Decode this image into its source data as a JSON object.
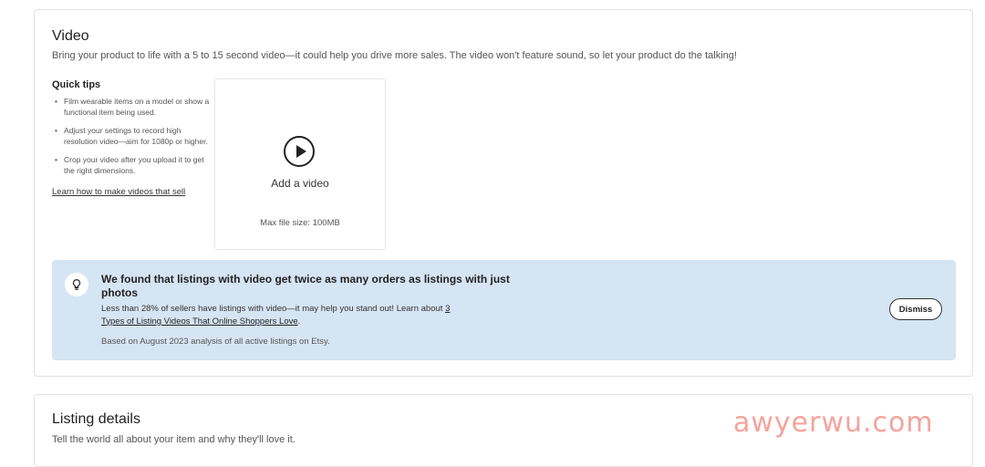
{
  "video_section": {
    "title": "Video",
    "description": "Bring your product to life with a 5 to 15 second video—it could help you drive more sales. The video won't feature sound, so let your product do the talking!",
    "tips": {
      "title": "Quick tips",
      "items": [
        "Film wearable items on a model or show a functional item being used.",
        "Adjust your settings to record high resolution video—aim for 1080p or higher.",
        "Crop your video after you upload it to get the right dimensions."
      ],
      "link": "Learn how to make videos that sell"
    },
    "upload": {
      "icon": "play-circle-icon",
      "label": "Add a video",
      "max_size": "Max file size: 100MB"
    },
    "banner": {
      "icon": "lightbulb-icon",
      "title": "We found that listings with video get twice as many orders as listings with just photos",
      "body_prefix": "Less than 28% of sellers have listings with video—it may help you stand out! Learn about ",
      "body_link": "3 Types of Listing Videos That Online Shoppers Love",
      "body_suffix": ".",
      "note": "Based on August 2023 analysis of all active listings on Etsy.",
      "dismiss_label": "Dismiss",
      "background_color": "#d6e5f3"
    }
  },
  "details_section": {
    "title": "Listing details",
    "description": "Tell the world all about your item and why they'll love it."
  },
  "watermark": "awyerwu.com"
}
